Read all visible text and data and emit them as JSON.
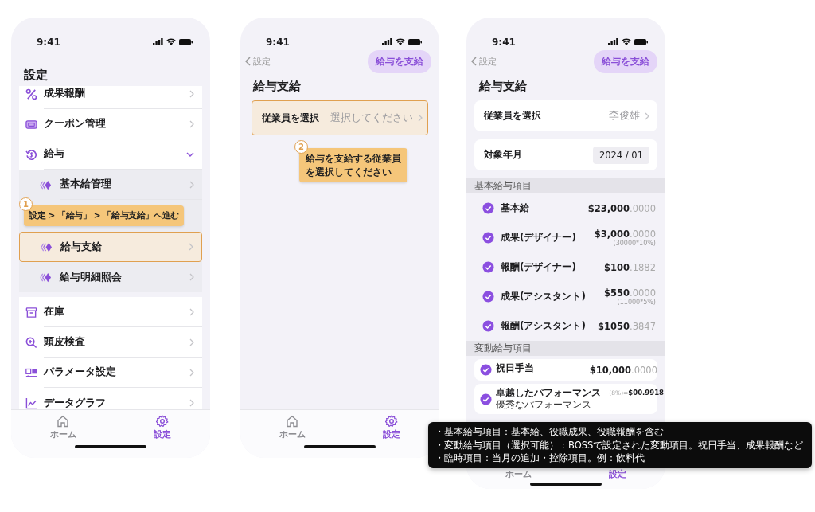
{
  "screen_1": {
    "status_time": "9:41",
    "title": "設定",
    "menu": [
      {
        "label": "成果報酬"
      },
      {
        "label": "クーポン管理"
      },
      {
        "label": "給与",
        "expanded": true,
        "children": [
          {
            "kind": "item",
            "label": "基本給管理",
            "highlighted": false
          },
          {
            "kind": "callout",
            "number": "1",
            "text": "設定 > 「給与」 > 「給与支給」へ進む"
          },
          {
            "kind": "item",
            "label": "給与支給",
            "highlighted": true
          },
          {
            "kind": "item",
            "label": "給与明細照会",
            "highlighted": false
          }
        ]
      }
    ],
    "menu_2": [
      {
        "label": "在庫"
      },
      {
        "label": "頭皮検査"
      },
      {
        "label": "パラメータ設定"
      },
      {
        "label": "データグラフ"
      }
    ],
    "tabs": [
      {
        "label": "ホーム",
        "selected": false
      },
      {
        "label": "設定",
        "selected": true
      }
    ]
  },
  "screen_2": {
    "status_time": "9:41",
    "back": "設定",
    "action": "給与を支給",
    "title": "給与支給",
    "employee": {
      "label": "従業員を選択",
      "placeholder": "選択してください",
      "highlighted": true
    },
    "callout": {
      "number": "2",
      "lines": [
        "給与を支給する従業員",
        "を選択してください"
      ]
    },
    "tabs": [
      {
        "label": "ホーム",
        "selected": false
      },
      {
        "label": "設定",
        "selected": true
      }
    ]
  },
  "screen_3": {
    "status_time": "9:41",
    "back": "設定",
    "action": "給与を支給",
    "title": "給与支給",
    "employee": {
      "label": "従業員を選択",
      "value": "李俊雄"
    },
    "period": {
      "label": "対象年月",
      "value": "2024 / 01"
    },
    "sections": [
      {
        "title": "基本給与項目",
        "kind": "plain",
        "items": [
          {
            "label": "基本給",
            "checked": true,
            "amount": "$23,000",
            "decimals": ".0000"
          },
          {
            "label": "成果(デザイナー)",
            "checked": true,
            "amount": "$3,000",
            "decimals": ".0000",
            "note": "(30000*10%)"
          },
          {
            "label": "報酬(デザイナー)",
            "checked": true,
            "amount": "$100",
            "decimals": ".1882"
          },
          {
            "label": "成果(アシスタント)",
            "checked": true,
            "amount": "$550",
            "decimals": ".0000",
            "note": "(11000*5%)"
          },
          {
            "label": "報酬(アシスタント)",
            "checked": true,
            "amount": "$1050",
            "decimals": ".3847"
          }
        ]
      },
      {
        "title": "変動給与項目",
        "kind": "card",
        "items": [
          {
            "label": "祝日手当",
            "checked": true,
            "amount": "$10,000",
            "decimals": ".0000"
          },
          {
            "label": "卓越したパフォーマンス",
            "sublabel": "優秀なパフォーマンス",
            "checked": true,
            "prefix": "(8%)=",
            "amount": "$00.9918"
          }
        ]
      }
    ],
    "tabs": [
      {
        "label": "ホーム",
        "selected": false
      },
      {
        "label": "設定",
        "selected": true
      }
    ]
  },
  "tooltip": {
    "lines": [
      "・基本給与項目：基本給、役職成果、役職報酬を含む",
      "・変動給与項目（選択可能）：BOSSで設定された変動項目。祝日手当、成果報酬など",
      "・臨時項目：当月の追加・控除項目。例：飲料代"
    ]
  }
}
